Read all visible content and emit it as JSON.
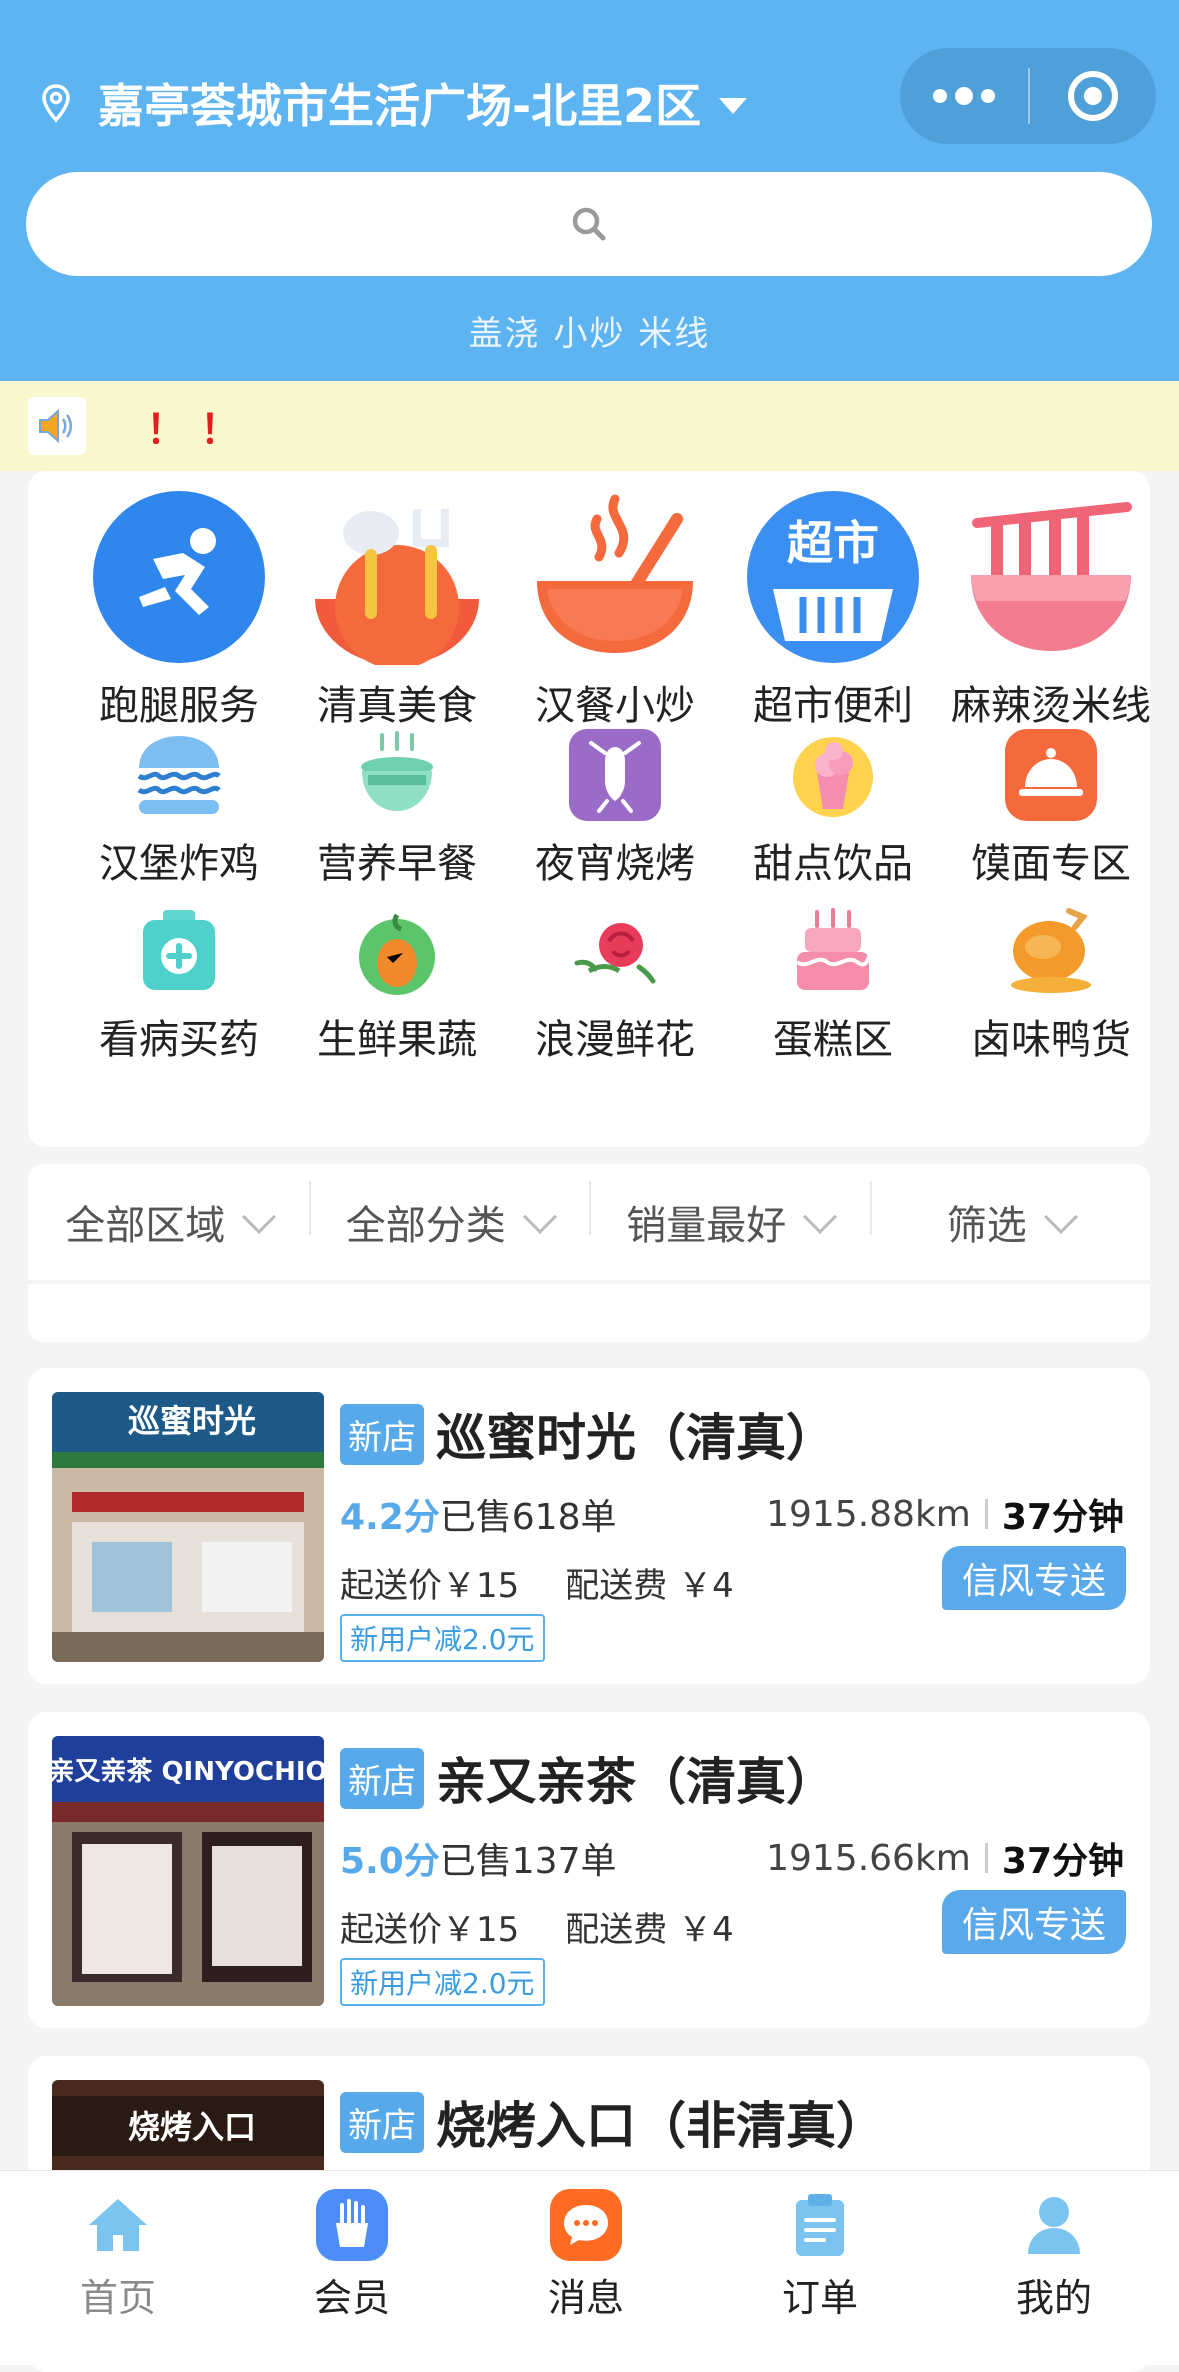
{
  "header": {
    "location": "嘉亭荟城市生活广场-北里2区",
    "search_hot": "盖浇 小炒 米线"
  },
  "notice": {
    "text": "！！"
  },
  "categories": [
    {
      "label": "跑腿服务",
      "icon": "running-man-icon"
    },
    {
      "label": "清真美食",
      "icon": "spoon-fork-icon"
    },
    {
      "label": "汉餐小炒",
      "icon": "bowl-icon"
    },
    {
      "label": "超市便利",
      "icon": "supermarket-basket-icon"
    },
    {
      "label": "麻辣烫米线",
      "icon": "noodle-bowl-icon"
    },
    {
      "label": "汉堡炸鸡",
      "icon": "burger-icon"
    },
    {
      "label": "营养早餐",
      "icon": "breakfast-pot-icon"
    },
    {
      "label": "夜宵烧烤",
      "icon": "crayfish-icon"
    },
    {
      "label": "甜点饮品",
      "icon": "ice-cream-icon"
    },
    {
      "label": "馍面专区",
      "icon": "food-cloche-icon"
    },
    {
      "label": "看病买药",
      "icon": "medicine-kit-icon"
    },
    {
      "label": "生鲜果蔬",
      "icon": "fruit-icon"
    },
    {
      "label": "浪漫鲜花",
      "icon": "rose-icon"
    },
    {
      "label": "蛋糕区",
      "icon": "cake-icon"
    },
    {
      "label": "卤味鸭货",
      "icon": "roast-duck-icon"
    }
  ],
  "filters": [
    "全部区域",
    "全部分类",
    "销量最好",
    "筛选"
  ],
  "shops": [
    {
      "badge": "新店",
      "name": "巡蜜时光（清真）",
      "rating": "4.2分",
      "sold": "已售618单",
      "distance": "1915.88km",
      "time": "37分钟",
      "min_order": "起送价￥15",
      "delivery_fee": "配送费 ￥4",
      "delivery_tag": "信风专送",
      "coupon": "新用户减2.0元",
      "sign_text": "巡蜜时光"
    },
    {
      "badge": "新店",
      "name": "亲又亲茶（清真）",
      "rating": "5.0分",
      "sold": "已售137单",
      "distance": "1915.66km",
      "time": "37分钟",
      "min_order": "起送价￥15",
      "delivery_fee": "配送费 ￥4",
      "delivery_tag": "信风专送",
      "coupon": "新用户减2.0元",
      "sign_text": "亲又亲茶 QINYOCHIO"
    },
    {
      "badge": "新店",
      "name": "烧烤入口（非清真）",
      "sign_text": "烧烤入口"
    }
  ],
  "tabbar": [
    {
      "label": "首页",
      "icon": "home-icon"
    },
    {
      "label": "会员",
      "icon": "fries-icon"
    },
    {
      "label": "消息",
      "icon": "message-icon"
    },
    {
      "label": "订单",
      "icon": "order-clipboard-icon"
    },
    {
      "label": "我的",
      "icon": "user-icon"
    }
  ],
  "colors": {
    "primary": "#5db4f0",
    "accent": "#57a9ea",
    "notice_bg": "#fbf8cf",
    "notice_text": "#e02020"
  }
}
